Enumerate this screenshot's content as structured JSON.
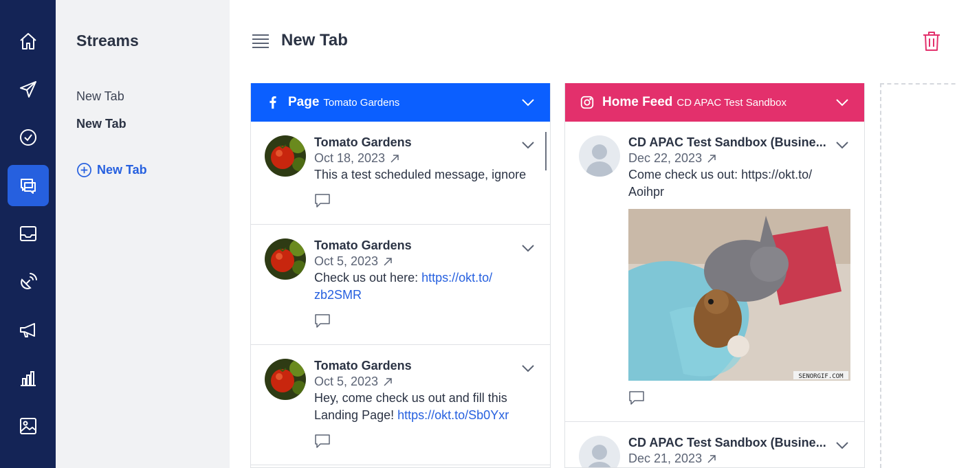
{
  "rail": {
    "items": [
      {
        "icon": "home-icon"
      },
      {
        "icon": "send-icon"
      },
      {
        "icon": "check-circle-icon"
      },
      {
        "icon": "streams-icon",
        "active": true
      },
      {
        "icon": "inbox-icon"
      },
      {
        "icon": "satellite-icon"
      },
      {
        "icon": "megaphone-icon"
      },
      {
        "icon": "analytics-icon"
      },
      {
        "icon": "media-library-icon"
      }
    ]
  },
  "streams_panel": {
    "title": "Streams",
    "tabs": [
      {
        "label": "New Tab"
      },
      {
        "label": "New Tab",
        "selected": true
      }
    ],
    "add_tab_label": "New Tab"
  },
  "header": {
    "title": "New Tab"
  },
  "columns": [
    {
      "network": "facebook",
      "color": "#0b5fff",
      "stream_type": "Page",
      "stream_name": "Tomato Gardens",
      "posts": [
        {
          "author": "Tomato Gardens",
          "date": "Oct 18, 2023",
          "text": "This a test scheduled message, ignore",
          "link": ""
        },
        {
          "author": "Tomato Gardens",
          "date": "Oct 5, 2023",
          "text": "Check us out here: ",
          "link": "https://okt.to/\nzb2SMR"
        },
        {
          "author": "Tomato Gardens",
          "date": "Oct 5, 2023",
          "text": "Hey, come check us out and fill this Landing Page! ",
          "link": "https://okt.to/Sb0Yxr"
        }
      ]
    },
    {
      "network": "instagram",
      "color": "#e3306c",
      "stream_type": "Home Feed",
      "stream_name": "CD APAC Test Sandbox",
      "posts": [
        {
          "author": "CD APAC Test Sandbox (Busine...",
          "date": "Dec 22, 2023",
          "text": "Come check us out: https://okt.to/\nAoihpr",
          "media_watermark": "SENORGIF.COM"
        },
        {
          "author": "CD APAC Test Sandbox (Busine...",
          "date": "Dec 21, 2023",
          "text": ""
        }
      ]
    }
  ],
  "colors": {
    "rail_bg": "#142456",
    "accent": "#2660df",
    "trash": "#e3306c"
  }
}
